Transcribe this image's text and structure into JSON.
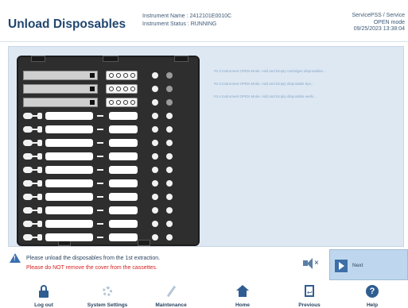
{
  "header": {
    "title": "Unload Disposables",
    "instrument_name_label": "Instrument Name : 2412101E0010C",
    "instrument_status_label": "Instrument Status : RUNNING",
    "user": "ServicePSS / Service",
    "mode": "OPEN mode",
    "datetime": "09/25/2023 13:38:04"
  },
  "messages": [
    "#2.2 Instrument OPEN Mode. Add and Empty cartridges disposables...",
    "#2.3 Instrument OPEN Mode. Add and Empty disposable tips...",
    "#2.4 Instrument OPEN Mode. Add and Empty disposable wells..."
  ],
  "footer": {
    "warning_line1": "Please unload the disposables from the 1st extraction.",
    "warning_line2": "Please do NOT remove the cover from the cassettes.",
    "next_label": "Next"
  },
  "nav": {
    "logout": "Log out",
    "system_settings": "System Settings",
    "maintenance": "Maintenance",
    "home": "Home",
    "previous": "Previous",
    "help": "Help"
  },
  "colors": {
    "accent": "#2f5d92",
    "panel_bg": "#dde8f3",
    "warning_text": "#d51f1f",
    "next_button_bg": "#bfd7ee"
  }
}
